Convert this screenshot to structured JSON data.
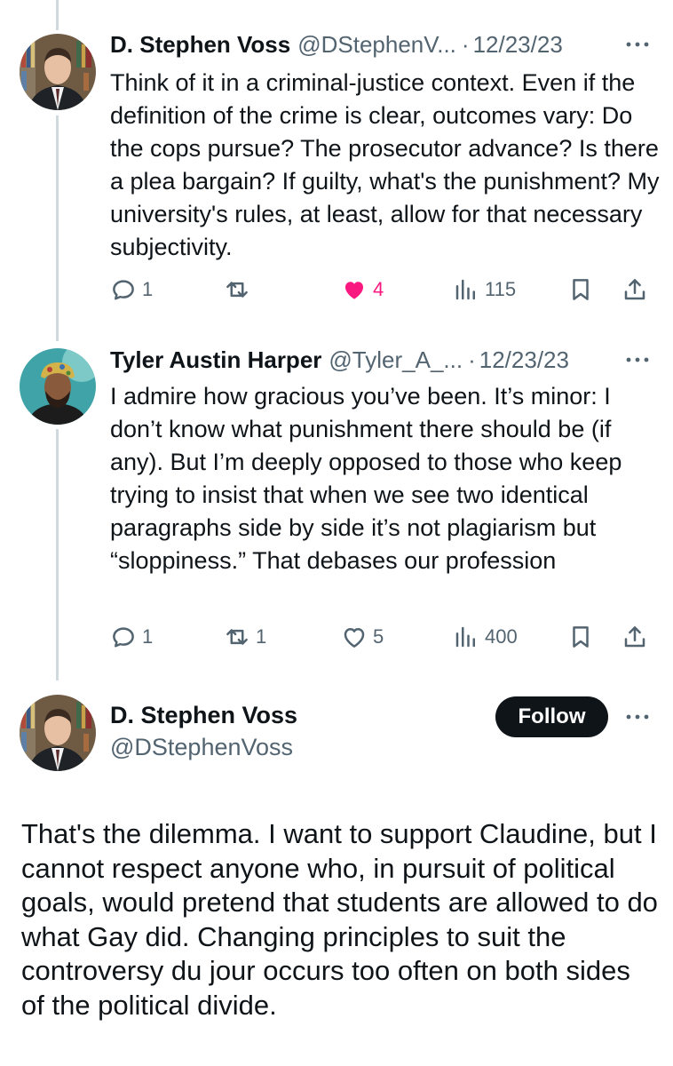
{
  "tweets": [
    {
      "author_name": "D. Stephen Voss",
      "handle": "@DStephenV...",
      "separator": "·",
      "date": "12/23/23",
      "more_icon": "more-dots-icon",
      "text": "Think of it in a criminal-justice context. Even if the definition of the crime is clear, outcomes vary: Do the cops pursue? The prosecutor advance? Is there a plea bargain? If guilty, what's the punishment? My university's rules, at least, allow for that necessary subjectivity.",
      "actions": {
        "reply_count": "1",
        "retweet_count": "",
        "like_count": "4",
        "liked": true,
        "views_count": "115"
      }
    },
    {
      "author_name": "Tyler Austin Harper",
      "handle": "@Tyler_A_...",
      "separator": "·",
      "date": "12/23/23",
      "more_icon": "more-dots-icon",
      "text": "I admire how gracious you’ve been. It’s minor: I don’t know what punishment there should be (if any). But I’m deeply opposed to those who keep trying to insist that when we see two identical paragraphs side by side it’s not plagiarism but “sloppiness.” That debases our profession",
      "actions": {
        "reply_count": "1",
        "retweet_count": "1",
        "like_count": "5",
        "liked": false,
        "views_count": "400"
      }
    }
  ],
  "main_tweet": {
    "author_name": "D. Stephen Voss",
    "handle": "@DStephenVoss",
    "follow_label": "Follow",
    "text": "That's the dilemma. I want to support Claudine, but I cannot respect anyone who, in pursuit of political goals, would pretend that students are allowed to do what Gay did. Changing principles to suit the controversy du jour occurs too often on both sides of the political divide."
  },
  "colors": {
    "text_primary": "#0f1419",
    "text_secondary": "#536471",
    "like_active": "#f91880",
    "thread_line": "#cfd9de",
    "follow_bg": "#0f1419"
  },
  "icons": [
    "reply-icon",
    "retweet-icon",
    "like-icon",
    "views-icon",
    "bookmark-icon",
    "share-icon",
    "more-dots-icon"
  ]
}
